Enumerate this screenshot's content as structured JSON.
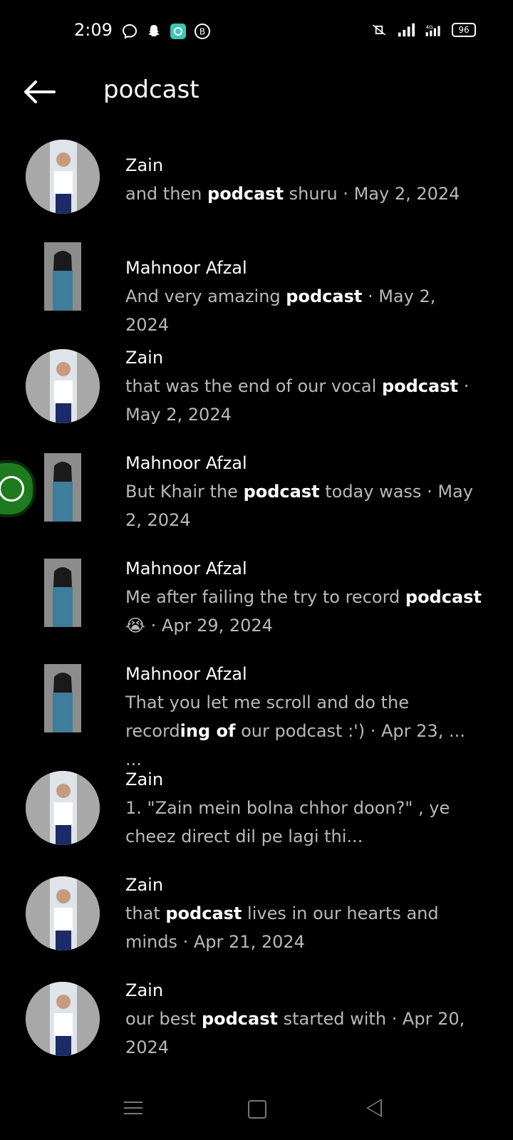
{
  "status_bar": {
    "time": "2:09",
    "battery": "96",
    "left_icons": [
      "messenger-facebook-icon",
      "snapchat-icon",
      "app-icon",
      "b-icon"
    ],
    "right_icons": [
      "mute-vibrate-icon",
      "signal-icon",
      "4g-signal-icon",
      "battery-icon"
    ]
  },
  "header": {
    "query": "podcast",
    "back_icon": "arrow-left-icon"
  },
  "results": [
    {
      "name": "Zain",
      "pre": "and then ",
      "hl": "podcast",
      "post": " shuru · May 2, 2024",
      "avatar": "round"
    },
    {
      "name": "Mahnoor Afzal",
      "pre": "And very amazing ",
      "hl": "podcast",
      "post": " · May 2, 2024",
      "avatar": "rect"
    },
    {
      "name": "Zain",
      "pre": "that was the end of our vocal ",
      "hl": "podcast",
      "post": " · May 2, 2024",
      "avatar": "round"
    },
    {
      "name": "Mahnoor Afzal",
      "pre": "But Khair the ",
      "hl": "podcast",
      "post": " today wass · May 2, 2024",
      "avatar": "rect"
    },
    {
      "name": "Mahnoor Afzal",
      "pre": "Me after failing the try to record ",
      "hl": "podcast",
      "post": " 😭 · Apr 29, 2024",
      "avatar": "rect"
    },
    {
      "name": "Mahnoor Afzal",
      "pre": "That you let me scroll and do the record",
      "hl": "ing of",
      "post": " our podcast :') · Apr 23, ... ...",
      "avatar": "rect"
    },
    {
      "name": "Zain",
      "pre": "1. \"Zain mein bolna chhor doon?\" , ye cheez direct dil pe lagi thi...",
      "hl": "",
      "post": "",
      "avatar": "round"
    },
    {
      "name": "Zain",
      "pre": "that ",
      "hl": "podcast",
      "post": " lives in our hearts and minds · Apr 21, 2024",
      "avatar": "round"
    },
    {
      "name": "Zain",
      "pre": "our best ",
      "hl": "podcast",
      "post": " started with · Apr 20, 2024",
      "avatar": "round"
    }
  ],
  "colors": {
    "background": "#000000",
    "snippet": "#b9b9b9",
    "fab": "#1f7a1f"
  },
  "nav_icons": [
    "menu-icon",
    "home-square-icon",
    "back-triangle-icon"
  ]
}
